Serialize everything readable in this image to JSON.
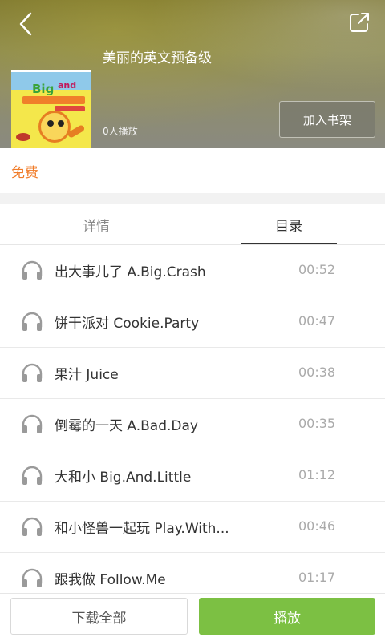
{
  "header": {
    "album_title": "美丽的英文预备级",
    "play_count": "0人播放",
    "add_to_shelf_label": "加入书架",
    "cover_brand": "Big",
    "cover_brand_suffix": "and"
  },
  "price": {
    "label": "免费",
    "color": "#f07b28"
  },
  "tabs": [
    {
      "label": "详情",
      "active": false
    },
    {
      "label": "目录",
      "active": true
    }
  ],
  "tracks": [
    {
      "title": "出大事儿了 A.Big.Crash",
      "duration": "00:52"
    },
    {
      "title": "饼干派对 Cookie.Party",
      "duration": "00:47"
    },
    {
      "title": "果汁 Juice",
      "duration": "00:38"
    },
    {
      "title": "倒霉的一天 A.Bad.Day",
      "duration": "00:35"
    },
    {
      "title": "大和小 Big.And.Little",
      "duration": "01:12"
    },
    {
      "title": "和小怪兽一起玩 Play.With...",
      "duration": "00:46"
    },
    {
      "title": "跟我做 Follow.Me",
      "duration": "01:17"
    }
  ],
  "bottom": {
    "download_all_label": "下载全部",
    "play_label": "播放",
    "play_color": "#7cc043"
  },
  "icons": {
    "back": "back-arrow-icon",
    "share": "share-icon",
    "track": "headphones-icon"
  }
}
